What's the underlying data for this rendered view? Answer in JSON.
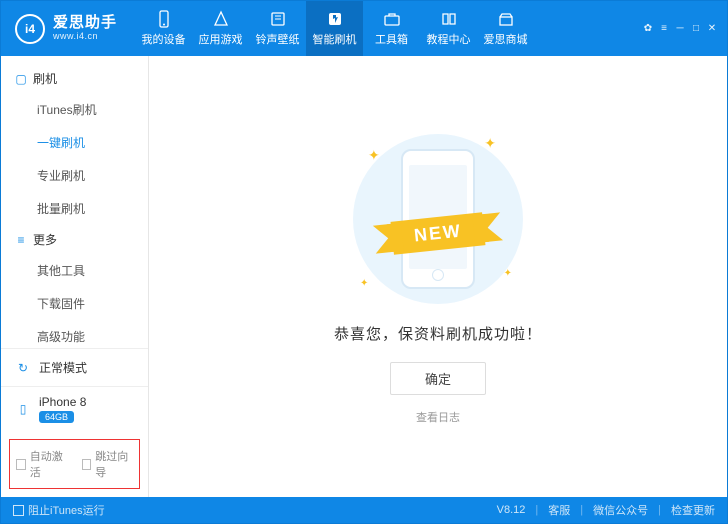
{
  "app": {
    "name": "爱思助手",
    "site": "www.i4.cn",
    "logo_text": "i4"
  },
  "header_tabs": [
    {
      "label": "我的设备",
      "icon": "phone-icon"
    },
    {
      "label": "应用游戏",
      "icon": "apps-icon"
    },
    {
      "label": "铃声壁纸",
      "icon": "music-icon"
    },
    {
      "label": "智能刷机",
      "icon": "flash-icon",
      "active": true
    },
    {
      "label": "工具箱",
      "icon": "toolbox-icon"
    },
    {
      "label": "教程中心",
      "icon": "book-icon"
    },
    {
      "label": "爱思商城",
      "icon": "shop-icon"
    }
  ],
  "sidebar": {
    "groups": [
      {
        "title": "刷机",
        "items": [
          {
            "label": "iTunes刷机"
          },
          {
            "label": "一键刷机",
            "active": true
          },
          {
            "label": "专业刷机"
          },
          {
            "label": "批量刷机"
          }
        ]
      },
      {
        "title": "更多",
        "items": [
          {
            "label": "其他工具"
          },
          {
            "label": "下载固件"
          },
          {
            "label": "高级功能"
          }
        ]
      }
    ],
    "mode": "正常模式",
    "device": {
      "name": "iPhone 8",
      "storage": "64GB"
    },
    "checks": {
      "auto_activate": "自动激活",
      "skip_guide": "跳过向导"
    }
  },
  "main": {
    "ribbon": "NEW",
    "message": "恭喜您，保资料刷机成功啦！",
    "ok": "确定",
    "view_log": "查看日志"
  },
  "footer": {
    "block_itunes": "阻止iTunes运行",
    "version": "V8.12",
    "support": "客服",
    "wechat": "微信公众号",
    "update": "检查更新"
  }
}
